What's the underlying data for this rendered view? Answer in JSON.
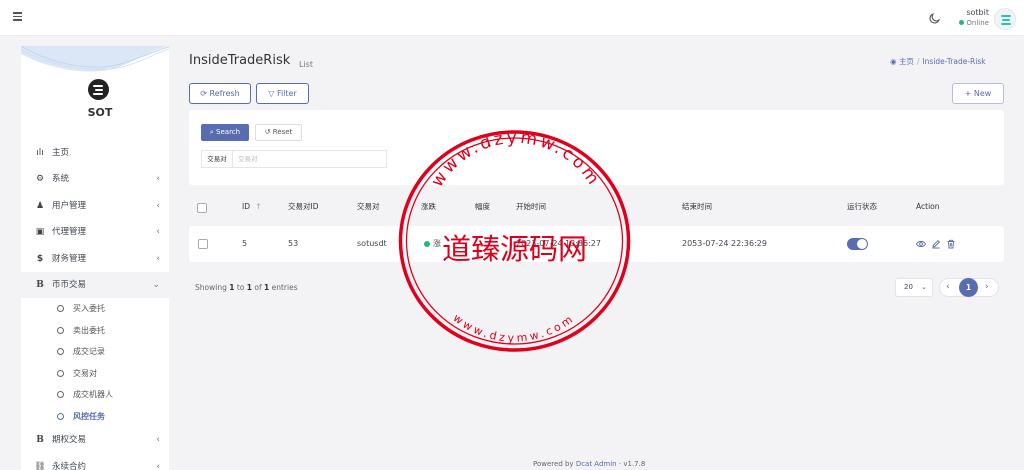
{
  "colors": {
    "accent": "#586cb1",
    "online": "#21b978",
    "stamp": "#e0001b",
    "brand": "#2ac5a8"
  },
  "navbar": {
    "menu_icon": "hamburger-icon",
    "theme_icon": "moon-icon",
    "user_name": "sotbit",
    "user_status": "Online"
  },
  "sidebar": {
    "brand": "SOT",
    "items": [
      {
        "label": "主页",
        "icon": "bar-chart-icon"
      },
      {
        "label": "系统",
        "icon": "gear-icon",
        "chevron": "‹"
      },
      {
        "label": "用户管理",
        "icon": "user-icon",
        "chevron": "‹"
      },
      {
        "label": "代理管理",
        "icon": "id-card-icon",
        "chevron": "‹"
      },
      {
        "label": "财务管理",
        "icon": "dollar-icon",
        "chevron": "‹"
      },
      {
        "label": "币币交易",
        "icon": "bitcoin-icon",
        "chevron": "⌄"
      }
    ],
    "sub_items": [
      {
        "label": "买入委托"
      },
      {
        "label": "卖出委托"
      },
      {
        "label": "成交记录"
      },
      {
        "label": "交易对"
      },
      {
        "label": "成交机器人"
      },
      {
        "label": "风控任务"
      }
    ],
    "items_after": [
      {
        "label": "期权交易",
        "icon": "bitcoin-icon",
        "chevron": "‹"
      },
      {
        "label": "永续合约",
        "icon": "link-icon",
        "chevron": "‹"
      }
    ]
  },
  "page": {
    "title": "InsideTradeRisk",
    "subtitle": "List",
    "breadcrumb_home": "主页",
    "breadcrumb_current": "Inside-Trade-Risk",
    "refresh_label": "Refresh",
    "filter_label": "Filter",
    "new_label": "New"
  },
  "filter": {
    "search_label": "Search",
    "reset_label": "Reset",
    "field_label": "交易对",
    "field_placeholder": "交易对"
  },
  "table": {
    "columns": [
      "ID",
      "交易对ID",
      "交易对",
      "涨跌",
      "幅度",
      "开始时间",
      "结束时间",
      "运行状态",
      "Action"
    ],
    "sort_icon": "↑",
    "rows": [
      {
        "id": "5",
        "pair_id": "53",
        "pair": "sotusdt",
        "direction": "涨",
        "range": "",
        "start_time": "2023-07-24 13:36:27",
        "end_time": "2053-07-24 22:36:29",
        "running": true
      }
    ]
  },
  "pagination": {
    "showing_prefix": "Showing",
    "from": "1",
    "to_word": "to",
    "to": "1",
    "of_word": "of",
    "total": "1",
    "entries_word": "entries",
    "per_page": "20",
    "current_page": "1"
  },
  "footer": {
    "prefix": "Powered by",
    "link": "Dcat Admin",
    "version": "v1.7.8"
  },
  "watermark": {
    "url_top": "www.dzymw.com",
    "url_bottom": "www.dzymw.com",
    "name": "道臻源码网"
  }
}
